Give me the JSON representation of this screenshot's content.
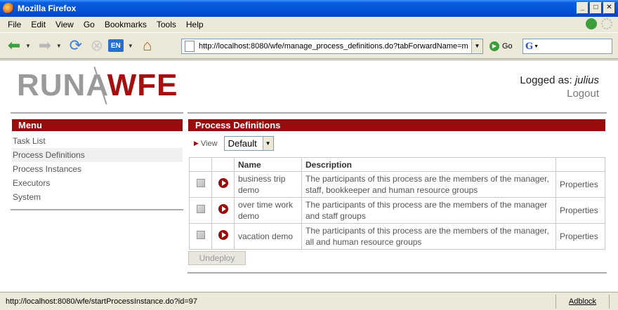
{
  "window": {
    "title": "Mozilla Firefox"
  },
  "menubar": {
    "items": [
      "File",
      "Edit",
      "View",
      "Go",
      "Bookmarks",
      "Tools",
      "Help"
    ]
  },
  "navbar": {
    "url": "http://localhost:8080/wfe/manage_process_definitions.do?tabForwardName=m",
    "go_label": "Go",
    "lang_label": "EN"
  },
  "header": {
    "logo_left": "RUNA",
    "logo_right": "WFE",
    "logged_prefix": "Logged as: ",
    "user": "julius",
    "logout": "Logout"
  },
  "sidebar": {
    "title": "Menu",
    "items": [
      "Task List",
      "Process Definitions",
      "Process Instances",
      "Executors",
      "System"
    ]
  },
  "main": {
    "title": "Process Definitions",
    "view_label": "View",
    "view_value": "Default",
    "columns": [
      "",
      "",
      "Name",
      "Description",
      ""
    ],
    "rows": [
      {
        "name": "business trip demo",
        "description": "The participants of this process are the members of the manager, staff, bookkeeper and human resource groups",
        "action": "Properties"
      },
      {
        "name": "over time work demo",
        "description": "The participants of this process are the members of the manager and staff groups",
        "action": "Properties"
      },
      {
        "name": "vacation demo",
        "description": "The participants of this process are the members of the manager, all and human resource groups",
        "action": "Properties"
      }
    ],
    "undeploy_label": "Undeploy"
  },
  "statusbar": {
    "text": "http://localhost:8080/wfe/startProcessInstance.do?id=97",
    "adblock": "Adblock"
  },
  "colors": {
    "accent": "#9c0b0b",
    "logo_gray": "#9a9a9a"
  }
}
